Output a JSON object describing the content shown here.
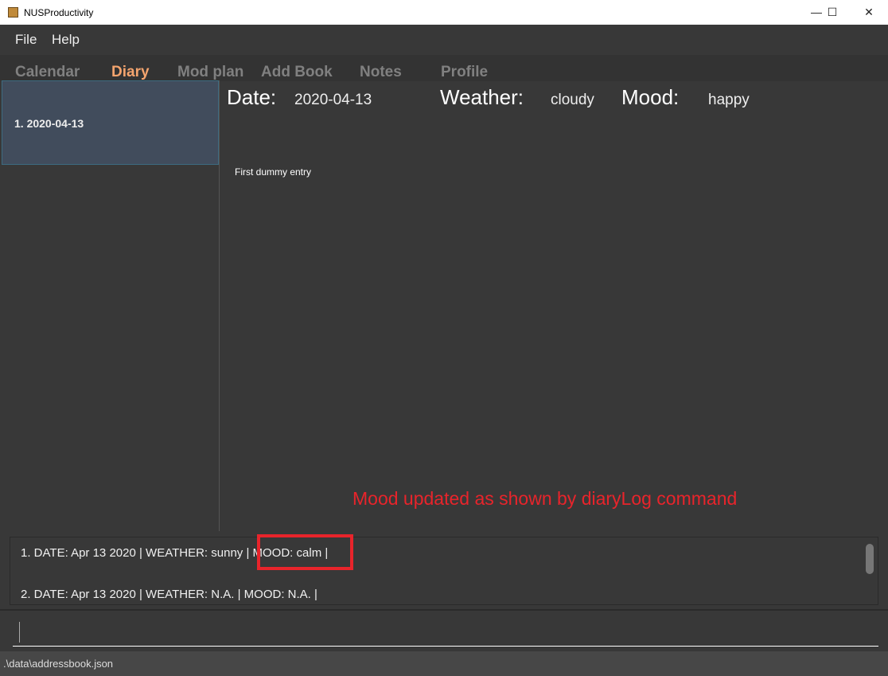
{
  "window": {
    "title": "NUSProductivity",
    "minimize": "—",
    "maximize": "☐",
    "close": "✕"
  },
  "menu": [
    "File",
    "Help"
  ],
  "tabs": [
    "Calendar",
    "Diary",
    "Mod plan",
    "Add Book",
    "Notes",
    "Profile"
  ],
  "active_tab": "Diary",
  "diary_list": [
    {
      "label": "1.  2020-04-13"
    }
  ],
  "entry": {
    "date_label": "Date:",
    "date": "2020-04-13",
    "weather_label": "Weather:",
    "weather": "cloudy",
    "mood_label": "Mood:",
    "mood": "happy",
    "text": "First dummy entry"
  },
  "annotation": "Mood updated as shown by diaryLog command",
  "log": [
    "1.  DATE: Apr 13 2020 | WEATHER: sunny | MOOD: calm |",
    "2.  DATE: Apr 13 2020 | WEATHER: N.A. | MOOD: N.A. |"
  ],
  "command_input": {
    "value": ""
  },
  "status": ".\\data\\addressbook.json",
  "colors": {
    "active_tab": "#f4a46e",
    "annotation": "#e8242b"
  }
}
